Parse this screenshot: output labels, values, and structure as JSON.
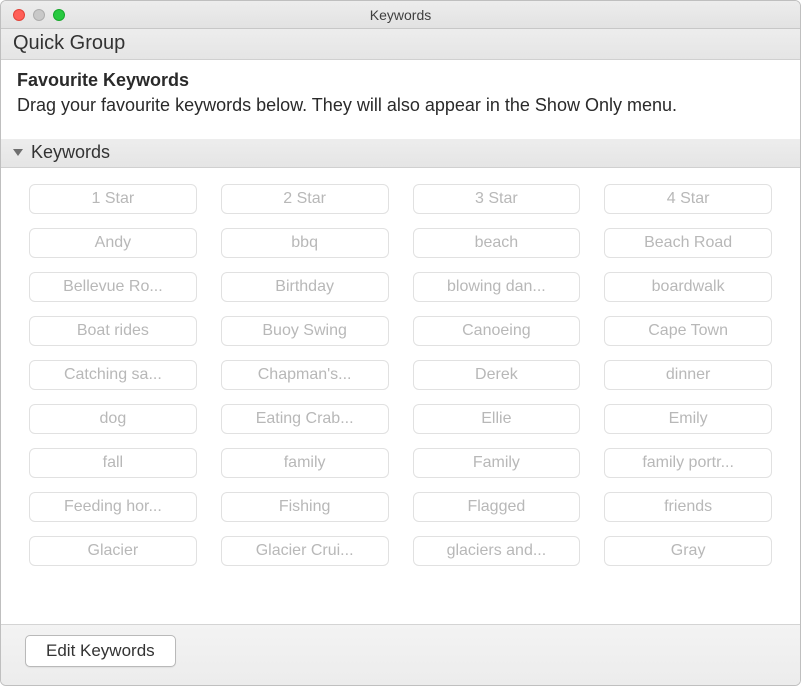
{
  "window": {
    "title": "Keywords"
  },
  "sections": {
    "quick_group_label": "Quick Group",
    "keywords_label": "Keywords"
  },
  "favourites": {
    "title": "Favourite Keywords",
    "description": "Drag your favourite keywords below. They will also appear in the Show Only menu."
  },
  "keywords": [
    "1 Star",
    "2 Star",
    "3 Star",
    "4 Star",
    "Andy",
    "bbq",
    "beach",
    "Beach Road",
    "Bellevue Ro...",
    "Birthday",
    "blowing dan...",
    "boardwalk",
    "Boat rides",
    "Buoy Swing",
    "Canoeing",
    "Cape Town",
    "Catching sa...",
    "Chapman's...",
    "Derek",
    "dinner",
    "dog",
    "Eating Crab...",
    "Ellie",
    "Emily",
    "fall",
    "family",
    "Family",
    "family portr...",
    "Feeding hor...",
    "Fishing",
    "Flagged",
    "friends",
    "Glacier",
    "Glacier Crui...",
    "glaciers and...",
    "Gray"
  ],
  "footer": {
    "edit_label": "Edit Keywords"
  }
}
